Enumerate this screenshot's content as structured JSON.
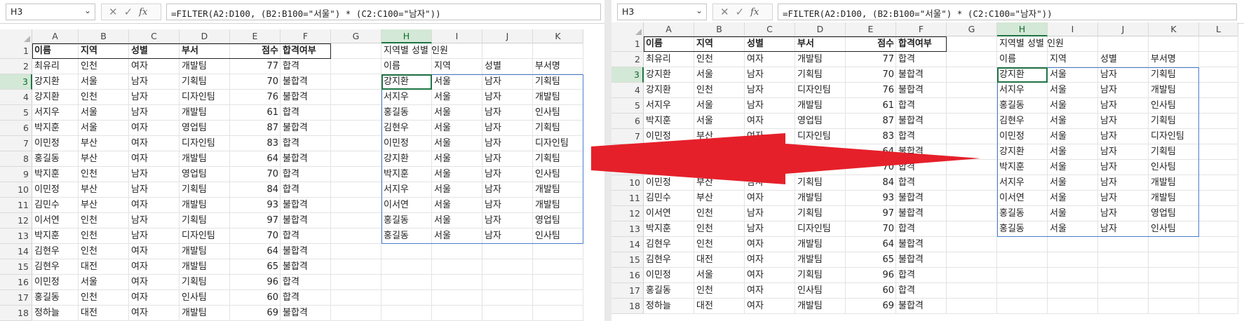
{
  "name_box": "H3",
  "formula": "=FILTER(A2:D100, (B2:B100=\"서울\") * (C2:C100=\"남자\"))",
  "toolbar_icons": [
    "cancel-icon",
    "enter-icon",
    "fx-icon"
  ],
  "toolbar_glyphs": {
    "cancel": "✕",
    "enter": "✓",
    "fx": "fx"
  },
  "columns": [
    "A",
    "B",
    "C",
    "D",
    "E",
    "F",
    "G",
    "H",
    "I",
    "J",
    "K",
    "L"
  ],
  "selected_column": "H",
  "selected_row": 3,
  "table_header": [
    "이름",
    "지역",
    "성별",
    "부서",
    "점수",
    "합격여부"
  ],
  "source_rows": [
    [
      "최유리",
      "인천",
      "여자",
      "개발팀",
      "77",
      "합격"
    ],
    [
      "강지환",
      "서울",
      "남자",
      "기획팀",
      "70",
      "불합격"
    ],
    [
      "강지환",
      "인천",
      "남자",
      "디자인팀",
      "76",
      "불합격"
    ],
    [
      "서지우",
      "서울",
      "남자",
      "개발팀",
      "61",
      "합격"
    ],
    [
      "박지훈",
      "서울",
      "여자",
      "영업팀",
      "87",
      "불합격"
    ],
    [
      "이민정",
      "부산",
      "여자",
      "디자인팀",
      "83",
      "합격"
    ],
    [
      "홍길동",
      "부산",
      "여자",
      "개발팀",
      "64",
      "불합격"
    ],
    [
      "박지훈",
      "인천",
      "남자",
      "영업팀",
      "70",
      "합격"
    ],
    [
      "이민정",
      "부산",
      "남자",
      "기획팀",
      "84",
      "합격"
    ],
    [
      "김민수",
      "부산",
      "여자",
      "개발팀",
      "93",
      "불합격"
    ],
    [
      "이서연",
      "인천",
      "남자",
      "기획팀",
      "97",
      "불합격"
    ],
    [
      "박지훈",
      "인천",
      "남자",
      "디자인팀",
      "70",
      "합격"
    ],
    [
      "김현우",
      "인천",
      "여자",
      "개발팀",
      "64",
      "불합격"
    ],
    [
      "김현우",
      "대전",
      "여자",
      "개발팀",
      "65",
      "불합격"
    ],
    [
      "이민정",
      "서울",
      "여자",
      "기획팀",
      "96",
      "합격"
    ],
    [
      "홍길동",
      "인천",
      "여자",
      "인사팀",
      "60",
      "합격"
    ],
    [
      "정하늘",
      "대전",
      "여자",
      "개발팀",
      "69",
      "불합격"
    ]
  ],
  "result_title": "지역별  성별 인원",
  "result_header": [
    "이름",
    "지역",
    "성별",
    "부서명"
  ],
  "result_rows": [
    [
      "강지환",
      "서울",
      "남자",
      "기획팀"
    ],
    [
      "서지우",
      "서울",
      "남자",
      "개발팀"
    ],
    [
      "홍길동",
      "서울",
      "남자",
      "인사팀"
    ],
    [
      "김현우",
      "서울",
      "남자",
      "기획팀"
    ],
    [
      "이민정",
      "서울",
      "남자",
      "디자인팀"
    ],
    [
      "강지환",
      "서울",
      "남자",
      "기획팀"
    ],
    [
      "박지훈",
      "서울",
      "남자",
      "인사팀"
    ],
    [
      "서지우",
      "서울",
      "남자",
      "개발팀"
    ],
    [
      "이서연",
      "서울",
      "남자",
      "개발팀"
    ],
    [
      "홍길동",
      "서울",
      "남자",
      "영업팀"
    ],
    [
      "홍길동",
      "서울",
      "남자",
      "인사팀"
    ]
  ],
  "colors": {
    "selection": "#217346",
    "spill_border": "#4a7fd0",
    "arrow": "#e5202a"
  }
}
